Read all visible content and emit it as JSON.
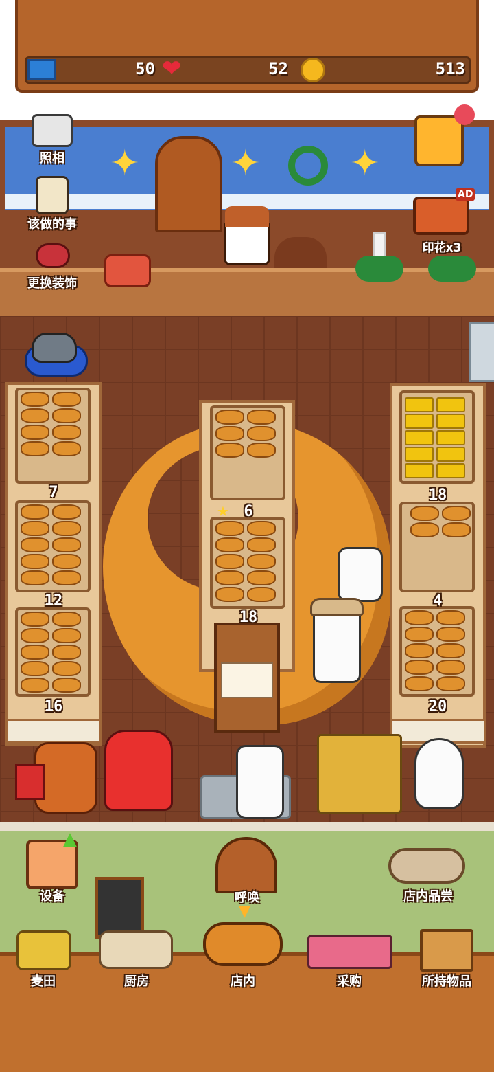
{
  "resources": {
    "tickets": "50",
    "hearts": "52",
    "coins": "513"
  },
  "left_menu": {
    "photo": "照相",
    "todo": "该做的事",
    "decor": "更换装饰"
  },
  "right_menu": {
    "ad_badge": "AD",
    "stamps": "印花x3"
  },
  "shelves": {
    "left": [
      "7",
      "12",
      "16"
    ],
    "center": [
      "6",
      "18"
    ],
    "right": [
      "18",
      "4",
      "20"
    ]
  },
  "actions": {
    "equipment": "设备",
    "summon": "呼唤",
    "tasting": "店内品尝"
  },
  "nav": {
    "field": "麦田",
    "kitchen": "厨房",
    "shop": "店内",
    "purchase": "采购",
    "inventory": "所持物品"
  },
  "colors": {
    "board": "#b5652b",
    "floor": "#7a3f26",
    "lawn": "#a8c27a",
    "nav": "#c0702e"
  }
}
